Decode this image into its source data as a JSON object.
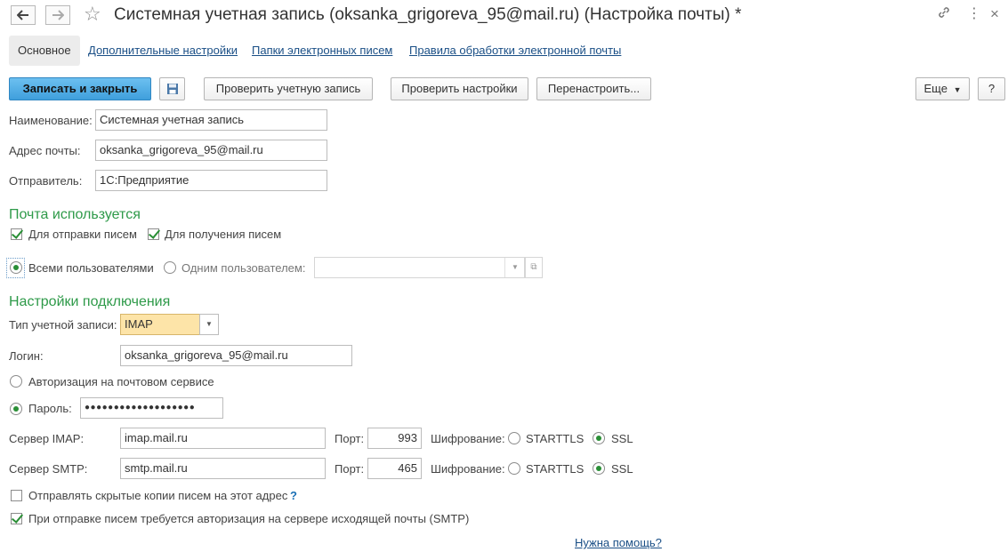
{
  "window": {
    "title": "Системная учетная запись (oksanka_grigoreva_95@mail.ru) (Настройка почты) *"
  },
  "tabs": [
    {
      "label": "Основное"
    },
    {
      "label": "Дополнительные настройки"
    },
    {
      "label": "Папки электронных писем"
    },
    {
      "label": "Правила обработки электронной почты"
    }
  ],
  "toolbar": {
    "save_close": "Записать и закрыть",
    "check_account": "Проверить учетную запись",
    "check_settings": "Проверить настройки",
    "reconfigure": "Перенастроить...",
    "more": "Еще",
    "help": "?"
  },
  "form": {
    "name_label": "Наименование:",
    "name_value": "Системная учетная запись",
    "email_label": "Адрес почты:",
    "email_value": "oksanka_grigoreva_95@mail.ru",
    "sender_label": "Отправитель:",
    "sender_value": "1С:Предприятие"
  },
  "usage": {
    "heading": "Почта используется",
    "send_label": "Для отправки писем",
    "send_checked": true,
    "receive_label": "Для получения писем",
    "receive_checked": true,
    "all_users_label": "Всеми пользователями",
    "one_user_label": "Одним пользователем:",
    "one_user_value": ""
  },
  "connection": {
    "heading": "Настройки подключения",
    "account_type_label": "Тип учетной записи:",
    "account_type_value": "IMAP",
    "login_label": "Логин:",
    "login_value": "oksanka_grigoreva_95@mail.ru",
    "auth_service_label": "Авторизация на почтовом сервисе",
    "password_label": "Пароль:",
    "password_value": "●●●●●●●●●●●●●●●●●●●",
    "imap_label": "Сервер IMAP:",
    "imap_value": "imap.mail.ru",
    "smtp_label": "Сервер SMTP:",
    "smtp_value": "smtp.mail.ru",
    "port_label": "Порт:",
    "imap_port": "993",
    "smtp_port": "465",
    "encryption_label": "Шифрование:",
    "starttls": "STARTTLS",
    "ssl": "SSL",
    "bcc_label": "Отправлять скрытые копии писем на этот адрес",
    "bcc_help": "?",
    "smtp_auth_label": "При отправке писем требуется авторизация на сервере исходящей почты (SMTP)"
  },
  "help_link": "Нужна помощь?",
  "colors": {
    "accent_green": "#2e9a49",
    "link_blue": "#1a4f86",
    "primary_button": "#3f9fdc",
    "combo_highlight": "#fde4a8"
  }
}
